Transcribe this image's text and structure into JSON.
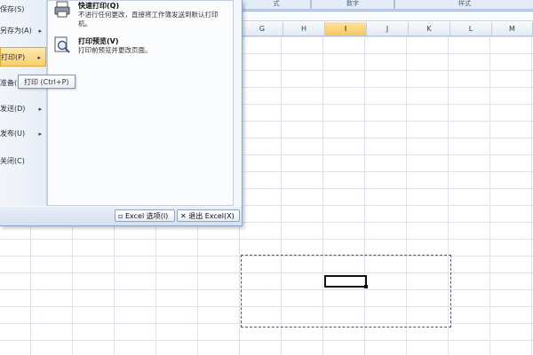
{
  "ribbon": {
    "groups": [
      "式",
      "数字",
      "样式"
    ]
  },
  "columns": {
    "headers": [
      "G",
      "H",
      "I",
      "J",
      "K",
      "L",
      "M"
    ],
    "active": "I"
  },
  "office_menu": {
    "items": [
      {
        "label": "保存(S)",
        "has_arrow": false
      },
      {
        "label": "另存为(A)",
        "has_arrow": true
      },
      {
        "label": "打印(P)",
        "has_arrow": true,
        "selected": true
      },
      {
        "label": "准备(E)",
        "has_arrow": true
      },
      {
        "label": "发送(D)",
        "has_arrow": true
      },
      {
        "label": "发布(U)",
        "has_arrow": true
      },
      {
        "label": "关闭(C)",
        "has_arrow": false
      }
    ],
    "submenu": [
      {
        "title": "快速打印(Q)",
        "description": "不进行任何更改，直接将工作簿发送到默认打印机。",
        "icon": "quick-print-icon"
      },
      {
        "title": "打印预览(V)",
        "description": "打印前预览并更改页面。",
        "icon": "print-preview-icon"
      }
    ],
    "footer": {
      "options_label": "Excel 选项(I)",
      "exit_label": "退出 Excel(X)"
    }
  },
  "tooltip": {
    "text": "打印 (Ctrl+P)"
  }
}
